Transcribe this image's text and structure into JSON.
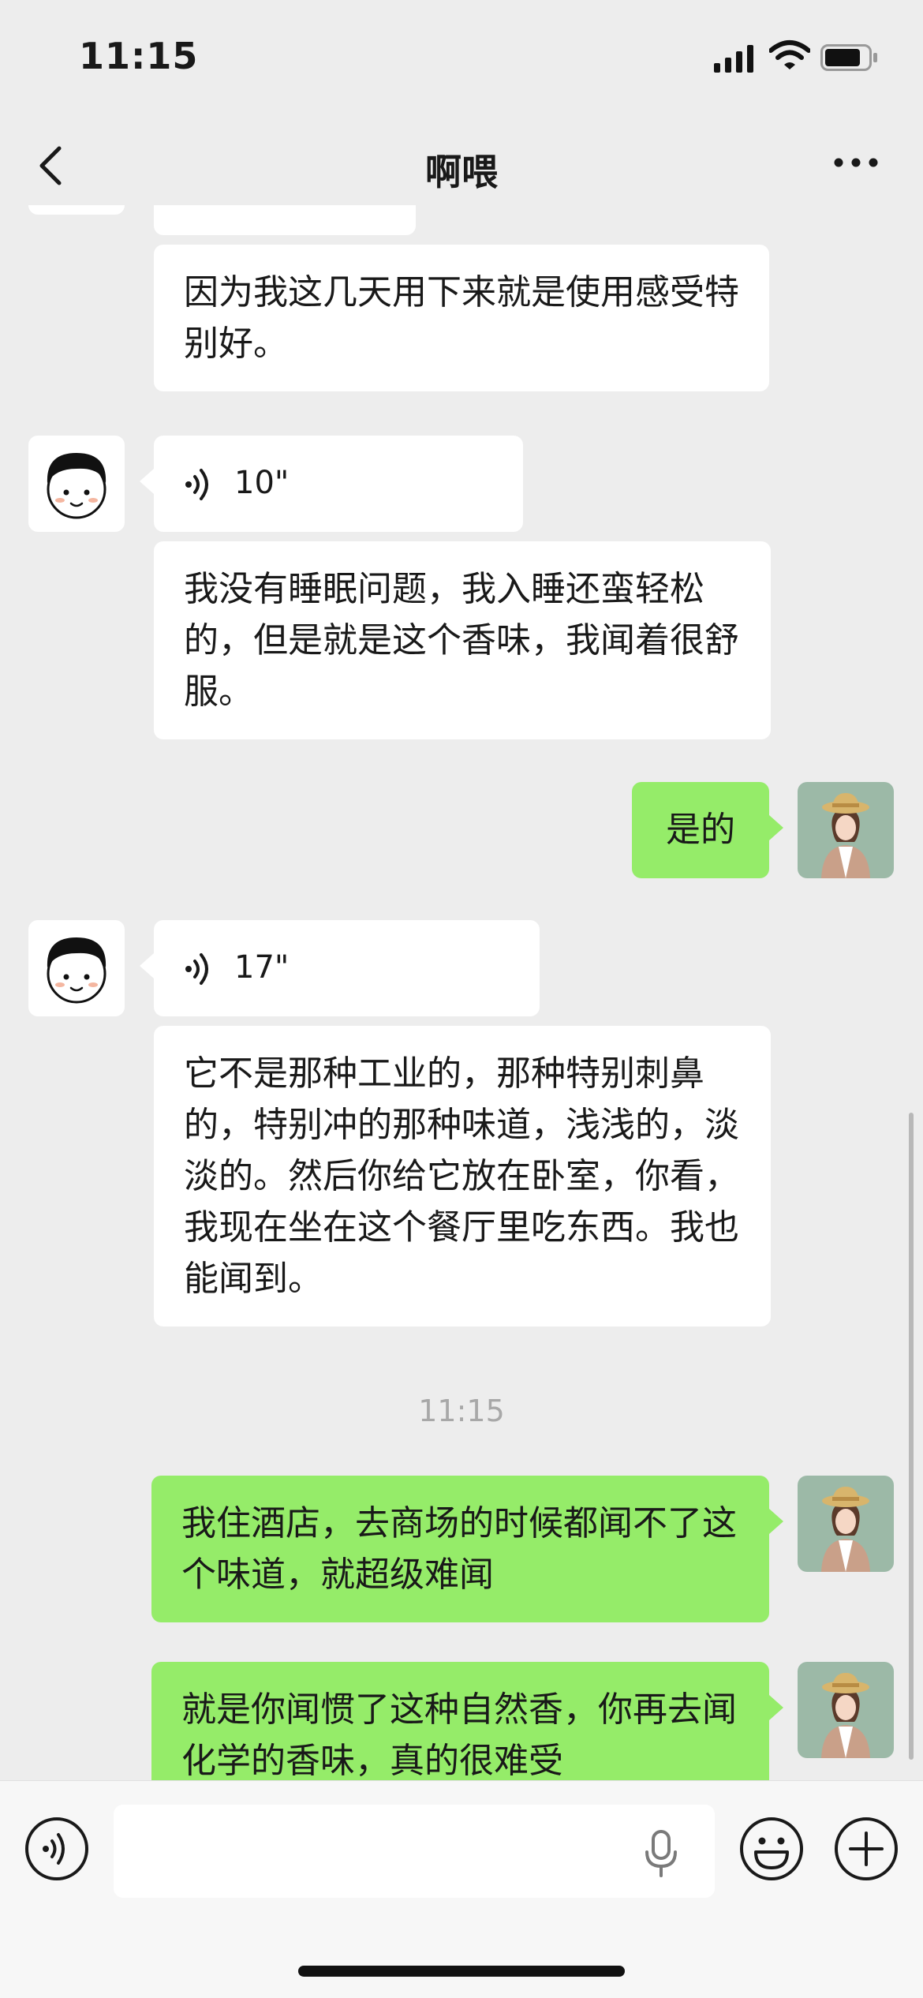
{
  "status_bar": {
    "time": "11:15"
  },
  "header": {
    "title": "啊喂"
  },
  "messages": [
    {
      "id": "m1",
      "side": "left",
      "type": "text",
      "text": "因为我这几天用下来就是使用感受特别好。"
    },
    {
      "id": "m2",
      "side": "left",
      "type": "voice",
      "duration": "10\""
    },
    {
      "id": "m3",
      "side": "left",
      "type": "text",
      "text": "我没有睡眠问题，我入睡还蛮轻松的，但是就是这个香味，我闻着很舒服。"
    },
    {
      "id": "m4",
      "side": "right",
      "type": "text",
      "text": "是的"
    },
    {
      "id": "m5",
      "side": "left",
      "type": "voice",
      "duration": "17\""
    },
    {
      "id": "m6",
      "side": "left",
      "type": "text",
      "text": "它不是那种工业的，那种特别刺鼻的，特别冲的那种味道，浅浅的，淡淡的。然后你给它放在卧室，你看，我现在坐在这个餐厅里吃东西。我也能闻到。"
    },
    {
      "id": "t1",
      "type": "timestamp",
      "text": "11:15"
    },
    {
      "id": "m7",
      "side": "right",
      "type": "text",
      "text": "我住酒店，去商场的时候都闻不了这个味道，就超级难闻"
    },
    {
      "id": "m8",
      "side": "right",
      "type": "text",
      "text": "就是你闻惯了这种自然香，你再去闻化学的香味，真的很难受"
    }
  ],
  "input_bar": {
    "value": "",
    "placeholder": ""
  },
  "icons": {
    "back": "chevron-left-icon",
    "more": "more-horizontal-icon",
    "voice": "voice-wave-icon",
    "mic": "microphone-icon",
    "emoji": "smiley-icon",
    "add": "plus-circle-icon"
  },
  "colors": {
    "background": "#ededed",
    "outgoing_bubble": "#95ec69",
    "incoming_bubble": "#ffffff",
    "timestamp": "#a8a8a8"
  }
}
